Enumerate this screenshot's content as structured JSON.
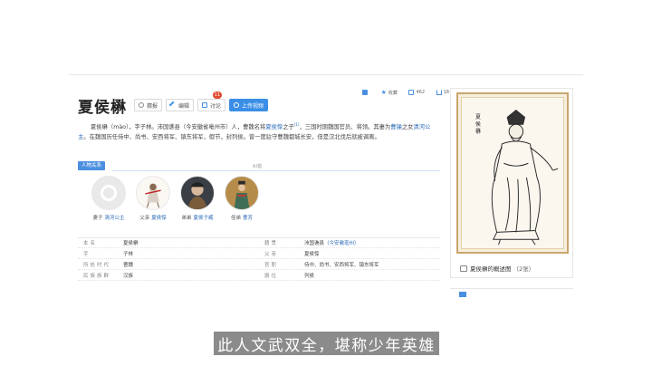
{
  "entry": {
    "title": "夏侯楙",
    "toolbar": {
      "report": "猜报",
      "edit": "编辑",
      "discuss": "讨论",
      "discuss_badge": "11",
      "upload": "上传视频"
    },
    "stats": {
      "collect": "收藏",
      "likes": "462",
      "shares": "18"
    }
  },
  "summary": {
    "seg1": "夏侯楙（mào），字子林。沛国谯县（今安徽省亳州市）人，曹魏名将",
    "link1": "夏侯惇",
    "seg2": "之子",
    "ref": "[1]",
    "seg3": "，三国时期魏国官员、将领。其妻为",
    "link2": "曹操",
    "seg4": "之女",
    "link3": "清河公主",
    "seg5": "。在魏国历任侍中、尚书、安西将军、镇东将军，假节，封列侯。曾一度驻守曹魏都城长安，但是汉北伐后就被调离。"
  },
  "relations": {
    "tag": "人物关系",
    "faded": "纠错",
    "people": [
      {
        "role": "妻子",
        "name": "清河公主"
      },
      {
        "role": "父亲",
        "name": "夏侯惇"
      },
      {
        "role": "弟弟",
        "name": "夏侯子臧"
      },
      {
        "role": "侄弟",
        "name": "曹芳"
      }
    ]
  },
  "infobox": [
    {
      "k1": "本名",
      "v1": "夏侯楙",
      "k2": "籍贯",
      "v2": "沛国谯县",
      "v2link": "（今安徽亳州）"
    },
    {
      "k1": "字",
      "v1": "子林",
      "k2": "父亲",
      "v2": "夏侯惇",
      "v2link": ""
    },
    {
      "k1": "所处时代",
      "v1": "曹魏",
      "k2": "官职",
      "v2": "侍中、尚书、安西将军、镇东将军",
      "v2link": ""
    },
    {
      "k1": "民族族群",
      "v1": "汉族",
      "k2": "爵位",
      "v2": "列侯",
      "v2link": ""
    }
  ],
  "side": {
    "caption": "夏侯楙",
    "summary_link": "夏侯楙的概述图",
    "count": "（2张）"
  },
  "subtitle": "此人文武双全，堪称少年英雄"
}
